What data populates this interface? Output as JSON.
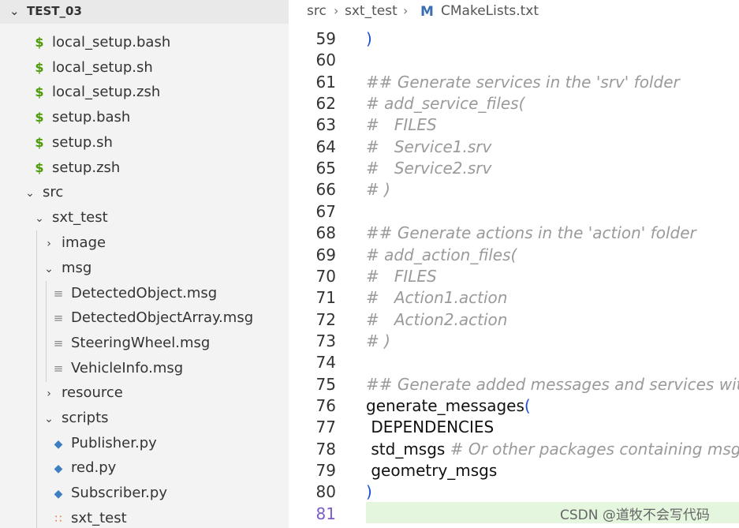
{
  "explorer": {
    "root_label": "TEST_03",
    "items": [
      {
        "label": "local_setup.bash",
        "icon": "dollar-icon"
      },
      {
        "label": "local_setup.sh",
        "icon": "dollar-icon"
      },
      {
        "label": "local_setup.zsh",
        "icon": "dollar-icon"
      },
      {
        "label": "setup.bash",
        "icon": "dollar-icon"
      },
      {
        "label": "setup.sh",
        "icon": "dollar-icon"
      },
      {
        "label": "setup.zsh",
        "icon": "dollar-icon"
      },
      {
        "label": "src",
        "icon": "chevron-down-icon"
      },
      {
        "label": "sxt_test",
        "icon": "chevron-down-icon"
      },
      {
        "label": "image",
        "icon": "chevron-right-icon"
      },
      {
        "label": "msg",
        "icon": "chevron-down-icon"
      },
      {
        "label": "DetectedObject.msg",
        "icon": "msg-file-icon"
      },
      {
        "label": "DetectedObjectArray.msg",
        "icon": "msg-file-icon"
      },
      {
        "label": "SteeringWheel.msg",
        "icon": "msg-file-icon"
      },
      {
        "label": "VehicleInfo.msg",
        "icon": "msg-file-icon"
      },
      {
        "label": "resource",
        "icon": "chevron-right-icon"
      },
      {
        "label": "scripts",
        "icon": "chevron-down-icon"
      },
      {
        "label": "Publisher.py",
        "icon": "python-icon"
      },
      {
        "label": "red.py",
        "icon": "python-icon"
      },
      {
        "label": "Subscriber.py",
        "icon": "python-icon"
      },
      {
        "label": "sxt_test",
        "icon": "rss-icon"
      }
    ]
  },
  "breadcrumb": {
    "parts": [
      "src",
      "sxt_test",
      "CMakeLists.txt"
    ],
    "file_icon": "M"
  },
  "editor": {
    "lines": [
      {
        "n": "59",
        "code": ")"
      },
      {
        "n": "60",
        "code": ""
      },
      {
        "n": "61",
        "code": "## Generate services in the 'srv' folder"
      },
      {
        "n": "62",
        "code": "# add_service_files("
      },
      {
        "n": "63",
        "code": "#   FILES"
      },
      {
        "n": "64",
        "code": "#   Service1.srv"
      },
      {
        "n": "65",
        "code": "#   Service2.srv"
      },
      {
        "n": "66",
        "code": "# )"
      },
      {
        "n": "67",
        "code": ""
      },
      {
        "n": "68",
        "code": "## Generate actions in the 'action' folder"
      },
      {
        "n": "69",
        "code": "# add_action_files("
      },
      {
        "n": "70",
        "code": "#   FILES"
      },
      {
        "n": "71",
        "code": "#   Action1.action"
      },
      {
        "n": "72",
        "code": "#   Action2.action"
      },
      {
        "n": "73",
        "code": "# )"
      },
      {
        "n": "74",
        "code": ""
      },
      {
        "n": "75",
        "code": "## Generate added messages and services with any"
      },
      {
        "n": "76",
        "code": "generate_messages("
      },
      {
        "n": "77",
        "code": " DEPENDENCIES"
      },
      {
        "n": "78",
        "code": " std_msgs",
        "comment": " # Or other packages containing msgs"
      },
      {
        "n": "79",
        "code": " geometry_msgs"
      },
      {
        "n": "80",
        "code": ")"
      },
      {
        "n": "81",
        "code": ""
      }
    ],
    "active_line": "81"
  },
  "watermark": "CSDN @道牧不会写代码",
  "colors": {
    "comment": "#9a9a9a",
    "paren": "#1c4fd7",
    "current_line": "#e4f6de",
    "sidebar_bg": "#f3f3f3",
    "shell_icon": "#4e9a06",
    "python_icon": "#3f7fbf"
  }
}
